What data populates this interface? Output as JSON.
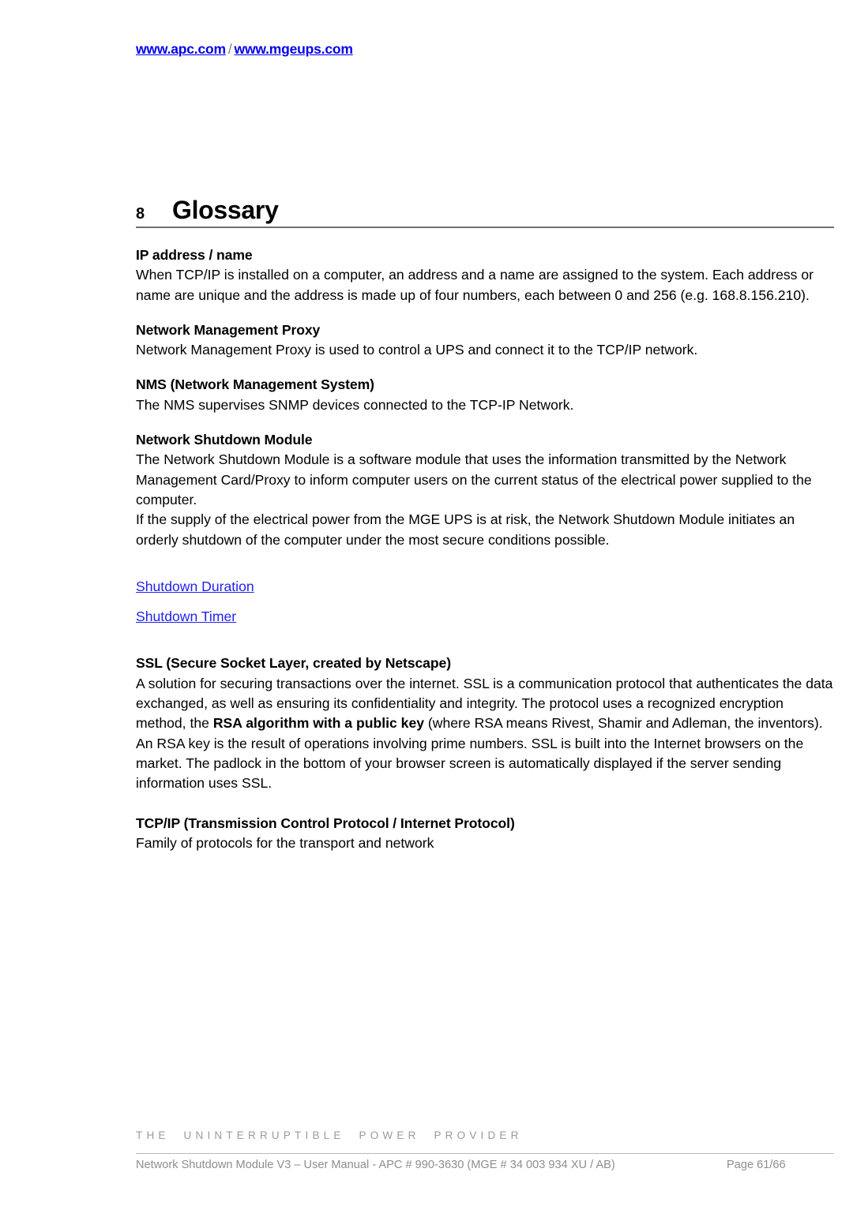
{
  "header": {
    "link_primary": "www.apc.com",
    "separator": "/",
    "link_secondary": "www.mgeups.com",
    "link_color": "#0000ee"
  },
  "chapter": {
    "number": "8",
    "title": "Glossary"
  },
  "glossary": {
    "entries": [
      {
        "term": "IP address / name",
        "definition": "When TCP/IP is installed on a computer, an address and a name are assigned to the system. Each address or name are unique and the address is made up of four numbers, each between 0 and 256 (e.g. 168.8.156.210)."
      },
      {
        "term": "Network Management Proxy",
        "definition": "Network Management Proxy is used to control a UPS and connect it to the TCP/IP network."
      },
      {
        "term": "NMS (Network Management System)",
        "definition": "The NMS supervises SNMP devices connected to the TCP-IP Network."
      },
      {
        "term": "Network Shutdown Module",
        "definition_part1": "The Network Shutdown Module is a software module that uses the information transmitted by the Network Management Card/Proxy to inform computer users on the current  status of the electrical power supplied to the computer.",
        "definition_part2": "If the supply of the electrical power from the MGE UPS is at risk, the Network Shutdown Module initiates an orderly shutdown of the computer under the most secure conditions possible."
      },
      {
        "term": "SSL (Secure Socket Layer, created by Netscape)",
        "definition_before_bold": "A solution for securing transactions over the internet. SSL is a communication protocol that authenticates the data exchanged, as well as ensuring its confidentiality and integrity. The protocol uses a recognized encryption method, the ",
        "definition_bold": "RSA algorithm with a public key",
        "definition_after_bold": " (where RSA means Rivest, Shamir and Adleman, the inventors). An RSA key is the result of operations involving prime numbers. SSL is built into the Internet browsers on the market. The padlock in the bottom of your browser screen is automatically displayed if the server sending information uses SSL."
      },
      {
        "term": "TCP/IP (Transmission Control Protocol / Internet Protocol)",
        "definition": "Family of protocols for the transport and network"
      }
    ],
    "cross_references": [
      "Shutdown Duration",
      "Shutdown Timer"
    ],
    "cross_reference_color": "#2222ee"
  },
  "footer": {
    "tagline": "THE UNINTERRUPTIBLE POWER PROVIDER",
    "document_line": "Network Shutdown Module V3 – User Manual - APC # 990-3630 (MGE # 34 003 934 XU / AB)",
    "page_label": "Page 61/66"
  }
}
